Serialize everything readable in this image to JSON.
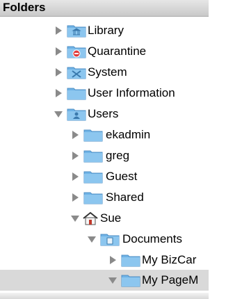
{
  "header": {
    "title": "Folders"
  },
  "tree": {
    "items": [
      {
        "label": "Library",
        "icon": "library-folder-icon",
        "expanded": false,
        "level": 1
      },
      {
        "label": "Quarantine",
        "icon": "quarantine-folder-icon",
        "expanded": false,
        "level": 1
      },
      {
        "label": "System",
        "icon": "system-folder-icon",
        "expanded": false,
        "level": 1
      },
      {
        "label": "User Information",
        "icon": "folder-icon",
        "expanded": false,
        "level": 1
      },
      {
        "label": "Users",
        "icon": "users-folder-icon",
        "expanded": true,
        "level": 1
      },
      {
        "label": "ekadmin",
        "icon": "folder-icon",
        "expanded": false,
        "level": 2
      },
      {
        "label": "greg",
        "icon": "folder-icon",
        "expanded": false,
        "level": 2
      },
      {
        "label": "Guest",
        "icon": "folder-icon",
        "expanded": false,
        "level": 2
      },
      {
        "label": "Shared",
        "icon": "folder-icon",
        "expanded": false,
        "level": 2
      },
      {
        "label": "Sue",
        "icon": "home-icon",
        "expanded": true,
        "level": 2
      },
      {
        "label": "Documents",
        "icon": "documents-folder-icon",
        "expanded": true,
        "level": 3
      },
      {
        "label": "My BizCar",
        "icon": "folder-icon",
        "expanded": false,
        "level": 4
      },
      {
        "label": "My PageM",
        "icon": "folder-icon",
        "expanded": true,
        "level": 4,
        "selected": true
      }
    ]
  },
  "colors": {
    "folder": "#79b9e8",
    "folder_dark": "#4f93c9",
    "selection": "#d9d9d9"
  }
}
